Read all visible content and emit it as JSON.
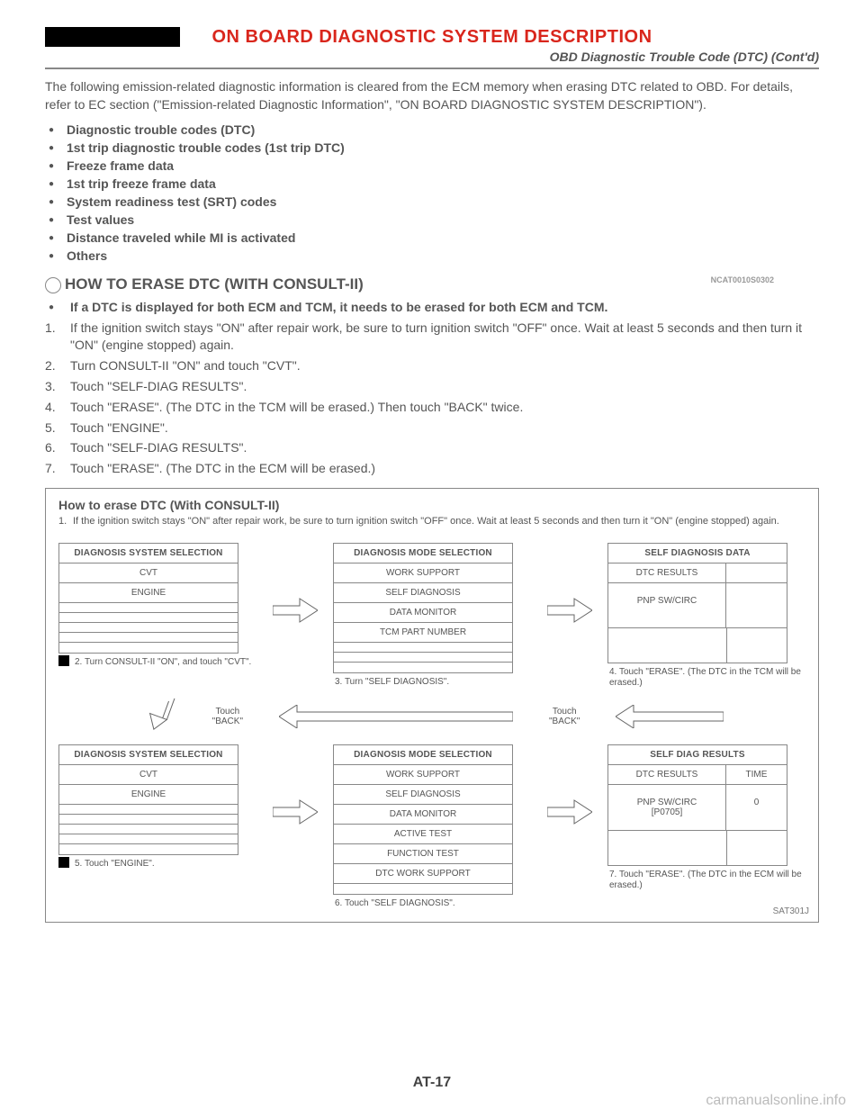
{
  "header": {
    "title": "ON BOARD DIAGNOSTIC SYSTEM DESCRIPTION",
    "subtitle": "OBD Diagnostic Trouble Code (DTC) (Cont'd)"
  },
  "intro": "The following emission-related diagnostic information is cleared from the ECM memory when erasing DTC related to OBD. For details, refer to EC section (\"Emission-related Diagnostic Information\", \"ON BOARD DIAGNOSTIC SYSTEM DESCRIPTION\").",
  "bullets": [
    "Diagnostic trouble codes (DTC)",
    "1st trip diagnostic trouble codes (1st trip DTC)",
    "Freeze frame data",
    "1st trip freeze frame data",
    "System readiness test (SRT) codes",
    "Test values",
    "Distance traveled while MI is activated",
    "Others"
  ],
  "section": {
    "heading": "HOW TO ERASE DTC (WITH CONSULT-II)",
    "refcode": "NCAT0010S0302",
    "items": [
      {
        "type": "bullet",
        "text": "If a DTC is displayed for both ECM and TCM, it needs to be erased for both ECM and TCM."
      },
      {
        "type": "num",
        "text": "If the ignition switch stays \"ON\" after repair work, be sure to turn ignition switch \"OFF\" once. Wait at least 5 seconds and then turn it \"ON\" (engine stopped) again."
      },
      {
        "type": "num",
        "text": "Turn CONSULT-II \"ON\" and touch \"CVT\"."
      },
      {
        "type": "num",
        "text": "Touch \"SELF-DIAG RESULTS\"."
      },
      {
        "type": "num",
        "text": "Touch \"ERASE\". (The DTC in the TCM will be erased.) Then touch \"BACK\" twice."
      },
      {
        "type": "num",
        "text": "Touch \"ENGINE\"."
      },
      {
        "type": "num",
        "text": "Touch \"SELF-DIAG RESULTS\"."
      },
      {
        "type": "num",
        "text": "Touch \"ERASE\". (The DTC in the ECM will be erased.)"
      }
    ]
  },
  "diagram": {
    "title": "How to erase DTC (With CONSULT-II)",
    "step1": "If the ignition switch stays \"ON\" after repair work, be sure to turn ignition switch \"OFF\" once. Wait at least 5 seconds and then turn it \"ON\" (engine stopped) again.",
    "row1": {
      "p1": {
        "header": "DIAGNOSIS SYSTEM SELECTION",
        "rows": [
          "CVT",
          "ENGINE",
          "",
          "",
          "",
          "",
          ""
        ]
      },
      "p2": {
        "header": "DIAGNOSIS MODE SELECTION",
        "rows": [
          "WORK SUPPORT",
          "SELF DIAGNOSIS",
          "DATA MONITOR",
          "TCM PART NUMBER",
          "",
          "",
          ""
        ]
      },
      "p3": {
        "header": "SELF DIAGNOSIS DATA",
        "subL": "DTC RESULTS",
        "subR": "",
        "bodyL": "PNP SW/CIRC",
        "bodyR": ""
      },
      "c1": "2. Turn CONSULT-II \"ON\", and touch \"CVT\".",
      "c2": "3. Turn \"SELF DIAGNOSIS\".",
      "c3": "4. Touch \"ERASE\". (The DTC in the TCM will be erased.)"
    },
    "back": {
      "label1": "Touch\n\"BACK\"",
      "label2": "Touch\n\"BACK\""
    },
    "row2": {
      "p1": {
        "header": "DIAGNOSIS SYSTEM SELECTION",
        "rows": [
          "CVT",
          "ENGINE",
          "",
          "",
          "",
          "",
          ""
        ]
      },
      "p2": {
        "header": "DIAGNOSIS MODE SELECTION",
        "rows": [
          "WORK SUPPORT",
          "SELF DIAGNOSIS",
          "DATA MONITOR",
          "ACTIVE TEST",
          "FUNCTION TEST",
          "DTC WORK SUPPORT",
          ""
        ]
      },
      "p3": {
        "header": "SELF DIAG RESULTS",
        "subL": "DTC RESULTS",
        "subR": "TIME",
        "bodyL": "PNP SW/CIRC\n[P0705]",
        "bodyR": "0"
      },
      "c1": "5. Touch \"ENGINE\".",
      "c2": "6. Touch \"SELF DIAGNOSIS\".",
      "c3": "7. Touch \"ERASE\". (The DTC in the ECM will be erased.)"
    },
    "refimg": "SAT301J"
  },
  "footer": {
    "page": "AT-17",
    "watermark": "carmanualsonline.info"
  }
}
